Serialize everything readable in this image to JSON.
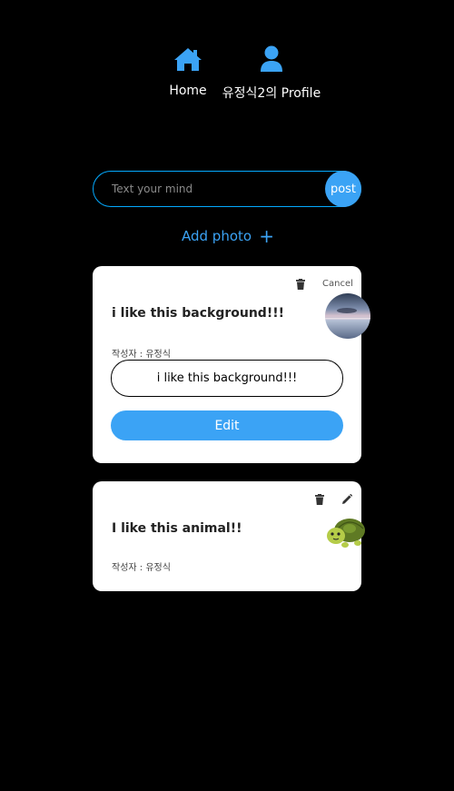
{
  "nav": {
    "home_label": "Home",
    "profile_label": "유정식2의 Profile",
    "icon_color": "#3ba3f5"
  },
  "post_form": {
    "placeholder": "Text your mind",
    "submit_label": "post",
    "add_photo_label": "Add photo",
    "add_photo_icon": "+"
  },
  "posts": [
    {
      "title": "i like this background!!!",
      "author": "작성자 : 유정식",
      "cancel_label": "Cancel",
      "edit_value": "i like this background!!!",
      "edit_button_label": "Edit",
      "attachment": "sunset-sea-photo"
    },
    {
      "title": "I like this animal!!",
      "author": "작성자 : 유정식",
      "attachment": "turtle-sticker"
    }
  ],
  "colors": {
    "background": "#000000",
    "accent": "#3ba3f5",
    "input_border": "#04aaff",
    "card": "#ffffff"
  }
}
